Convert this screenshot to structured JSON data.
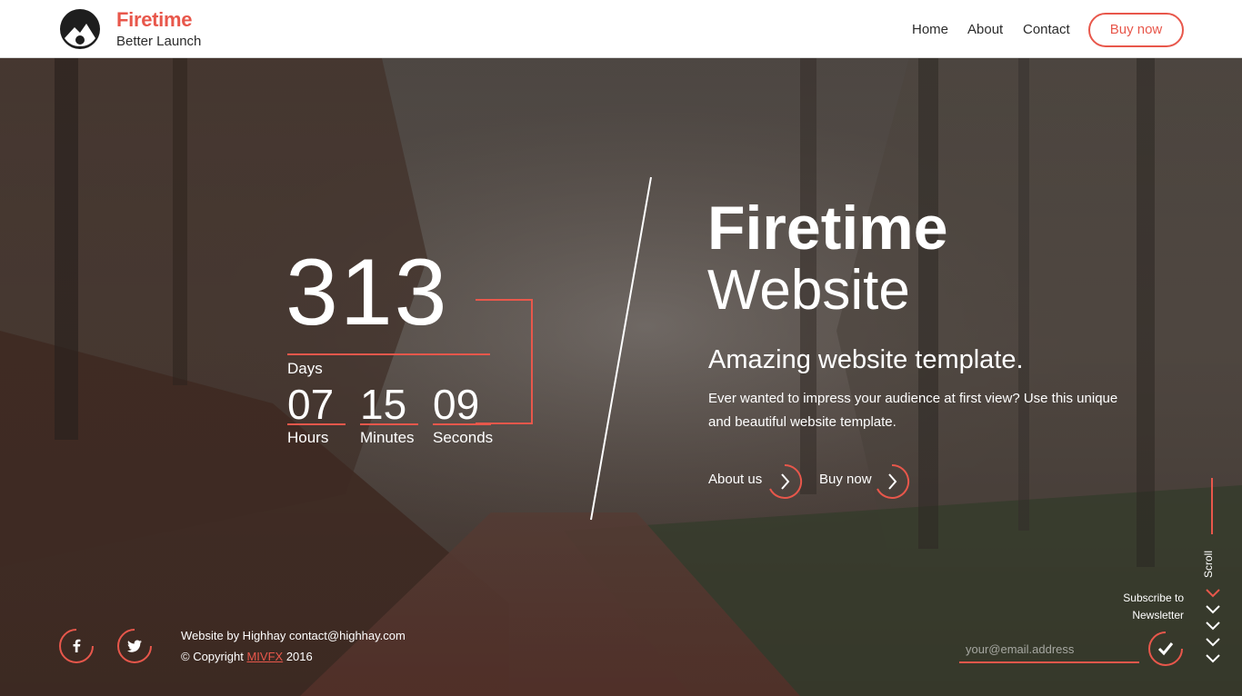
{
  "header": {
    "brand_name": "Firetime",
    "brand_tagline": "Better Launch",
    "nav": [
      "Home",
      "About",
      "Contact"
    ],
    "buy_button": "Buy now"
  },
  "countdown": {
    "days": "313",
    "days_label": "Days",
    "hours": "07",
    "hours_label": "Hours",
    "minutes": "15",
    "minutes_label": "Minutes",
    "seconds": "09",
    "seconds_label": "Seconds"
  },
  "hero": {
    "title": "Firetime",
    "subtitle": "Website",
    "tagline": "Amazing website template.",
    "description": "Ever wanted to impress your audience at first view? Use this unique and beautiful website template.",
    "about_label": "About us",
    "buy_label": "Buy now"
  },
  "footer": {
    "credit": "Website by Highhay contact@highhay.com",
    "copyright_prefix": "© Copyright",
    "copyright_link": "MIVFX",
    "copyright_year": "2016",
    "social": [
      "facebook-icon",
      "twitter-icon"
    ]
  },
  "newsletter": {
    "label_line1": "Subscribe to",
    "label_line2": "Newsletter",
    "placeholder": "your@email.address",
    "submit_icon": "check-icon"
  },
  "scroll": {
    "label": "Scroll",
    "icon": "chevron-down-icon"
  },
  "colors": {
    "accent": "#e8574b",
    "header_bg": "#ffffff",
    "text_dark": "#2b2b2b"
  }
}
